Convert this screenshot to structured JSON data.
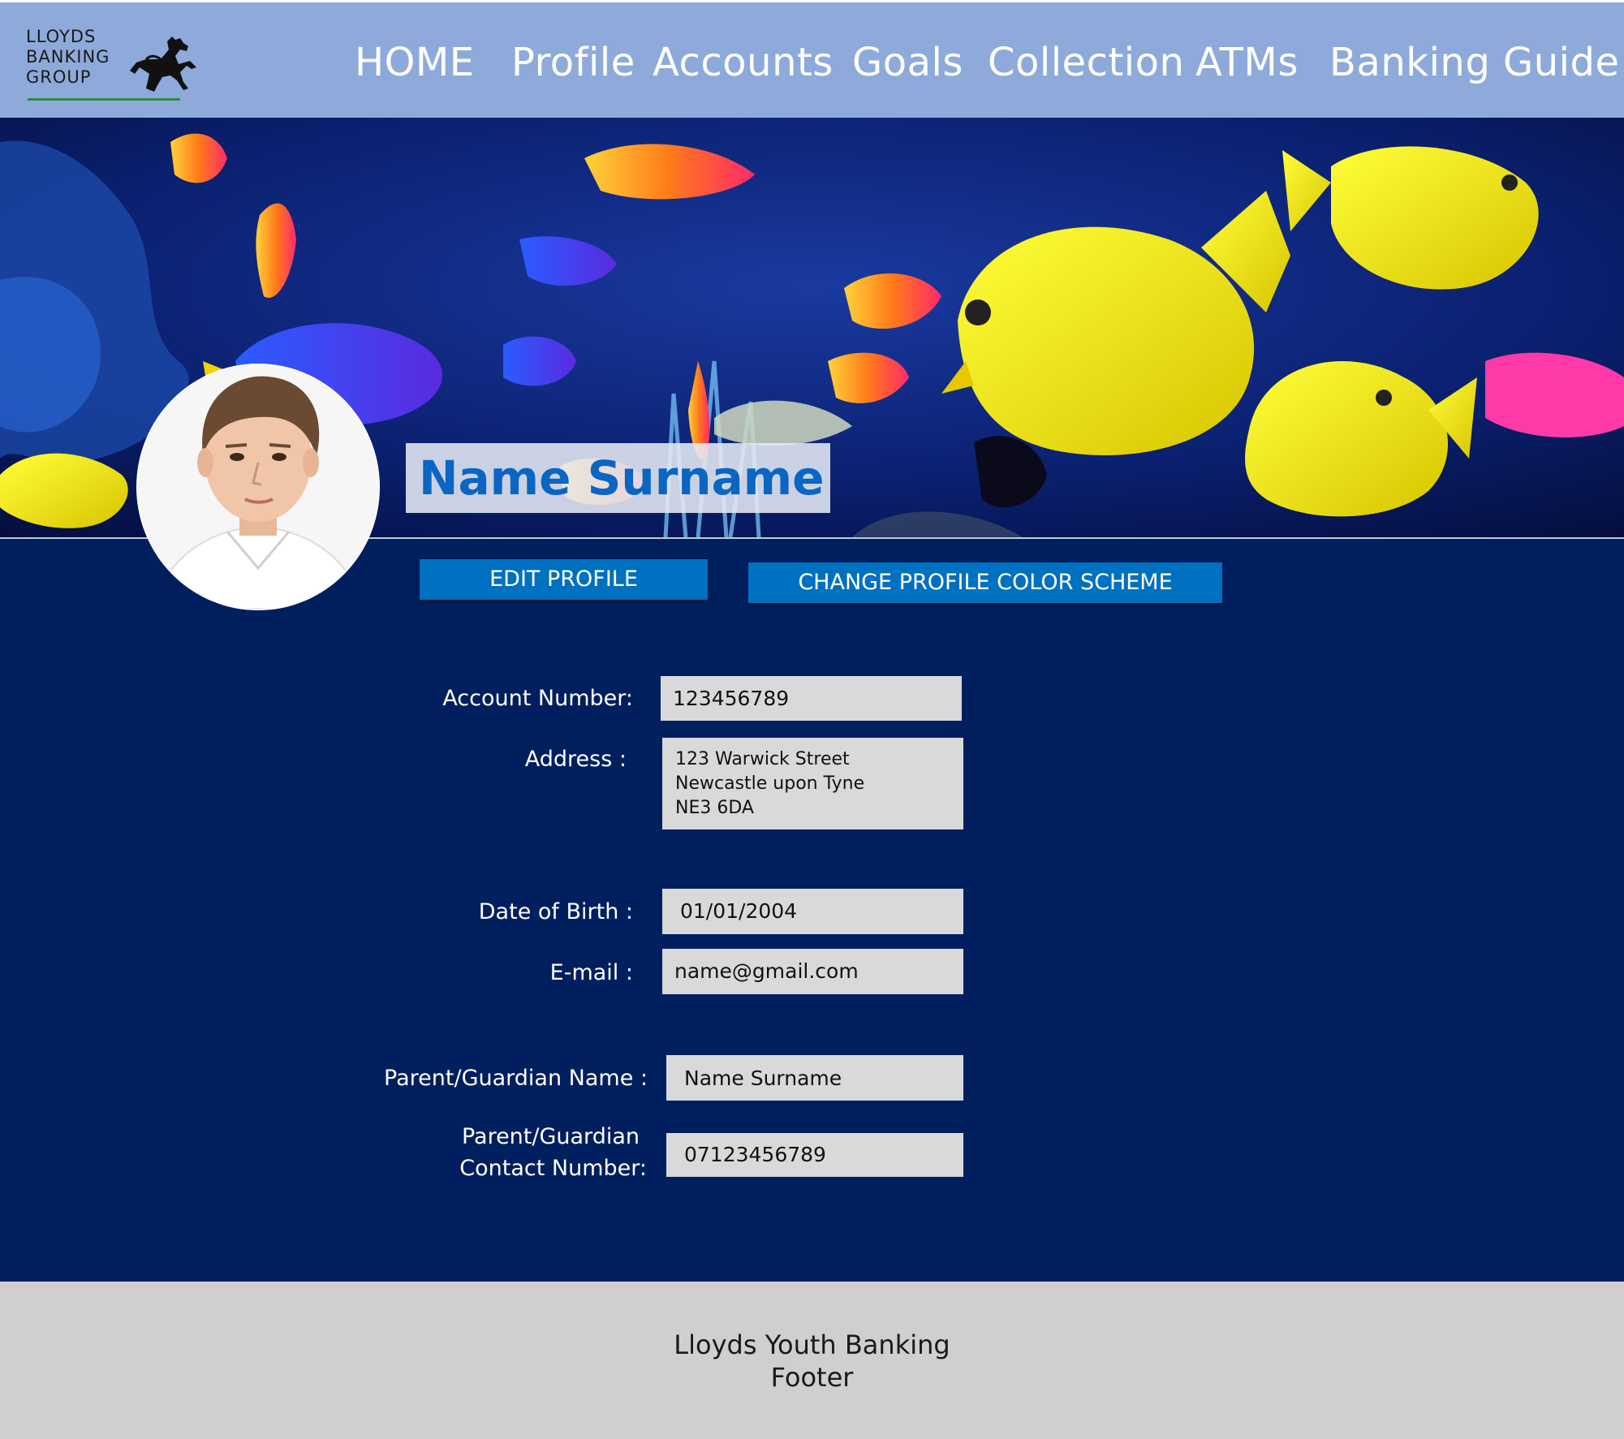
{
  "brand": {
    "logo_text": "LLOYDS\nBANKING\nGROUP",
    "accent_green": "#2e8b3a"
  },
  "nav": {
    "items": [
      "HOME",
      "Profile",
      "Accounts",
      "Goals",
      "Collection",
      "ATMs",
      "Banking Guide"
    ]
  },
  "profile": {
    "name": "Name Surname",
    "edit_button": "EDIT PROFILE",
    "color_scheme_button": "CHANGE PROFILE COLOR SCHEME"
  },
  "fields": {
    "account_number": {
      "label": "Account Number:",
      "value": "123456789"
    },
    "address": {
      "label": "Address :",
      "value": "123 Warwick Street\nNewcastle upon Tyne\nNE3 6DA"
    },
    "dob": {
      "label": "Date of Birth :",
      "value": "01/01/2004"
    },
    "email": {
      "label": "E-mail  :",
      "value": "name@gmail.com"
    },
    "guardian_name": {
      "label": "Parent/Guardian Name :",
      "value": "Name Surname"
    },
    "guardian_contact": {
      "label_line1": "Parent/Guardian",
      "label_line2": "Contact Number:",
      "value": "07123456789"
    }
  },
  "footer": {
    "text": "Lloyds Youth Banking\nFooter"
  },
  "colors": {
    "header_bg": "#8eaadb",
    "main_bg": "#001f5e",
    "button_bg": "#0070c0",
    "field_bg": "#d9d9d9",
    "footer_bg": "#d0cece",
    "name_color": "#0a66c2"
  }
}
